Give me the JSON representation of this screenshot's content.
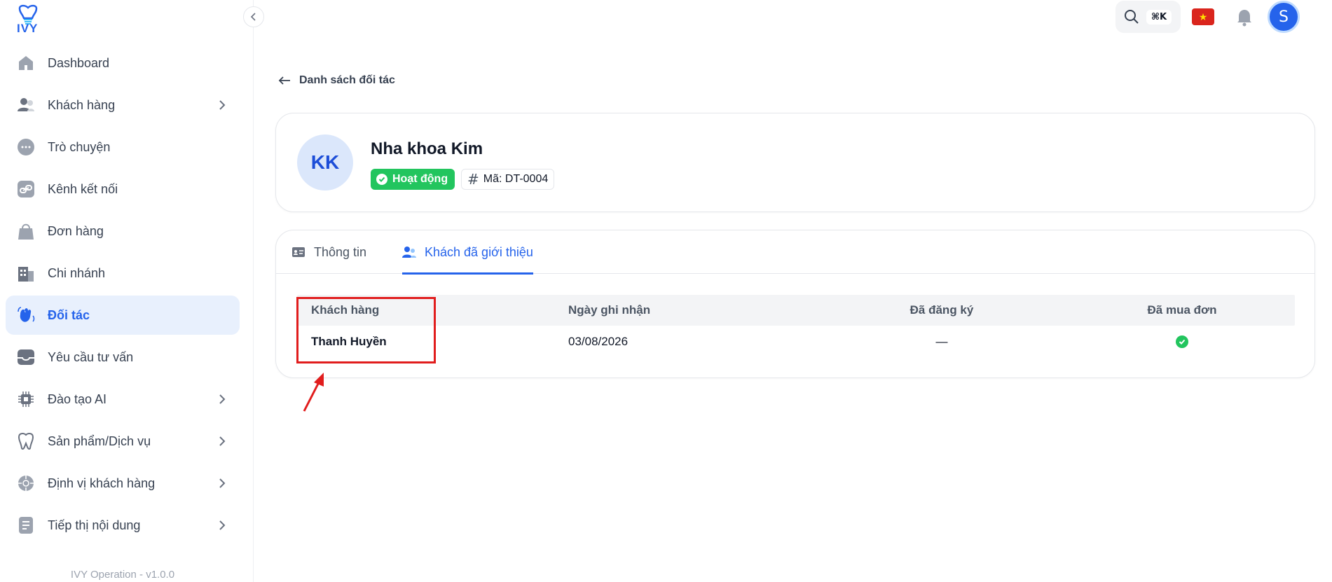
{
  "app": {
    "logo_text": "IVY",
    "version": "IVY Operation - v1.0.0"
  },
  "sidebar": {
    "items": [
      {
        "label": "Dashboard",
        "icon": "home-icon",
        "chevron": false
      },
      {
        "label": "Khách hàng",
        "icon": "users-icon",
        "chevron": true
      },
      {
        "label": "Trò chuyện",
        "icon": "chat-icon",
        "chevron": false
      },
      {
        "label": "Kênh kết nối",
        "icon": "link-icon",
        "chevron": false
      },
      {
        "label": "Đơn hàng",
        "icon": "bag-icon",
        "chevron": false
      },
      {
        "label": "Chi nhánh",
        "icon": "building-icon",
        "chevron": false
      },
      {
        "label": "Đối tác",
        "icon": "handshake-icon",
        "chevron": false,
        "active": true
      },
      {
        "label": "Yêu cầu tư vấn",
        "icon": "inbox-icon",
        "chevron": false
      },
      {
        "label": "Đào tạo AI",
        "icon": "chip-icon",
        "chevron": true
      },
      {
        "label": "Sản phẩm/Dịch vụ",
        "icon": "tooth-icon",
        "chevron": true
      },
      {
        "label": "Định vị khách hàng",
        "icon": "target-icon",
        "chevron": true
      },
      {
        "label": "Tiếp thị nội dung",
        "icon": "document-icon",
        "chevron": true
      }
    ]
  },
  "topbar": {
    "shortcut": "⌘K",
    "avatar_initial": "S",
    "flag_symbol": "★"
  },
  "page": {
    "back_label": "Danh sách đối tác",
    "partner": {
      "initials": "KK",
      "name": "Nha khoa Kim",
      "status": "Hoạt động",
      "code": "Mã: DT-0004"
    },
    "tabs": [
      {
        "label": "Thông tin"
      },
      {
        "label": "Khách đã giới thiệu",
        "active": true
      }
    ],
    "table": {
      "headers": [
        "Khách hàng",
        "Ngày ghi nhận",
        "Đã đăng ký",
        "Đã mua đơn"
      ],
      "rows": [
        {
          "customer": "Thanh Huyền",
          "date": "03/08/2026",
          "registered": "—",
          "purchased": true
        }
      ]
    }
  },
  "colors": {
    "accent": "#2563eb",
    "success": "#22c55e",
    "annotation": "#e11d1d"
  }
}
